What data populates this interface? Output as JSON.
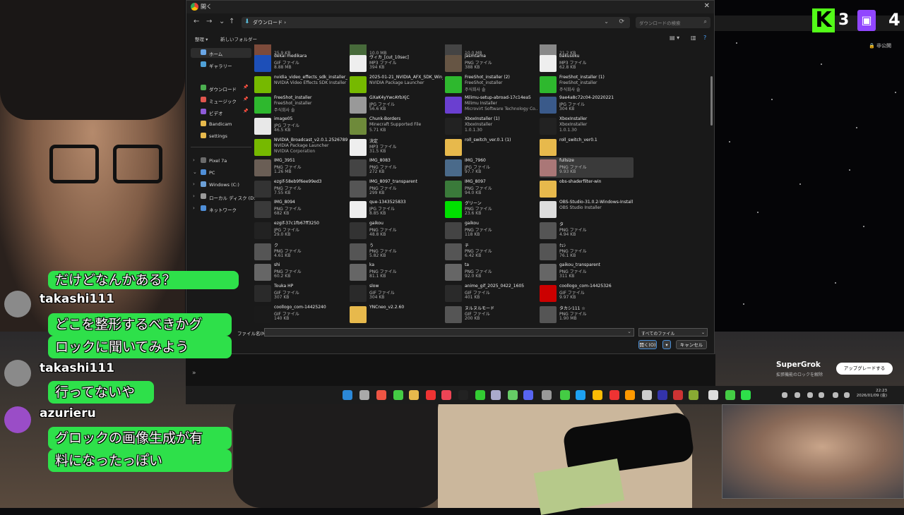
{
  "window": {
    "title": "開く",
    "close": "✕"
  },
  "nav": {
    "back": "←",
    "forward": "→",
    "down": "⌄",
    "up": "↑",
    "path": "ダウンロード",
    "path_sep": "›",
    "chevron": "⌄",
    "refresh": "⟳",
    "search_placeholder": "ダウンロードの検索",
    "search_icon": "⌕"
  },
  "toolbar": {
    "organize": "整理 ▾",
    "new_folder": "新しいフォルダー",
    "view": "▤ ▾",
    "pane": "▥",
    "help": "?"
  },
  "sidebar": [
    {
      "label": "ホーム",
      "color": "#6aa7e8",
      "active": true
    },
    {
      "label": "ギャラリー",
      "color": "#4fa0d6"
    },
    {
      "label": "ダウンロード",
      "color": "#4caf50",
      "pin": "📌"
    },
    {
      "label": "ミュージック",
      "color": "#e0554d",
      "pin": "📌"
    },
    {
      "label": "ビデオ",
      "color": "#8e5bd9",
      "pin": "📌"
    },
    {
      "label": "Bandicam",
      "color": "#e7b94c"
    },
    {
      "label": "settings",
      "color": "#e7b94c"
    },
    {
      "label": "Pixel 7a",
      "color": "#6b6b6b",
      "exp": "›"
    },
    {
      "label": "PC",
      "color": "#4f8fd8",
      "exp": "⌄"
    },
    {
      "label": "Windows (C:)",
      "color": "#6b9fd6",
      "exp": "›"
    },
    {
      "label": "ローカル ディスク (D:",
      "color": "#9a9a9a",
      "exp": "›"
    },
    {
      "label": "ネットワーク",
      "color": "#4f8fd8",
      "exp": "›"
    }
  ],
  "files": [
    [
      {
        "name": "",
        "l2": "",
        "l3": "25.9 KB",
        "color": "#7c4a3a"
      },
      {
        "name": "dekai medikara",
        "l2": "GIF ファイル",
        "l3": "8.88 MB",
        "color": "#1d4fb8"
      },
      {
        "name": "nvidia_video_effects_sdk_installer_v0.7.6_ada",
        "l2": "NVIDIA Video Effects SDK Installer",
        "l3": "",
        "color": "#76b900"
      },
      {
        "name": "FreeShot_installer",
        "l2": "FreeShot_installer",
        "l3": "주식회사 솔",
        "color": "#2eb82e"
      },
      {
        "name": "image05",
        "l2": "JPG ファイル",
        "l3": "46.5 KB",
        "color": "#e8e8e8"
      },
      {
        "name": "NVIDIA_Broadcast_v2.0.1.25267890",
        "l2": "NVIDIA Package Launcher",
        "l3": "NVIDIA Corporation",
        "color": "#76b900"
      },
      {
        "name": "IMG_3951",
        "l2": "PNG ファイル",
        "l3": "1.26 MB",
        "color": "#6a5e55"
      },
      {
        "name": "ezgif-58eb9f6ee99ed3",
        "l2": "PNG ファイル",
        "l3": "7.55 KB",
        "color": "#333"
      },
      {
        "name": "IMG_8094",
        "l2": "PNG ファイル",
        "l3": "682 KB",
        "color": "#3a3a3a"
      },
      {
        "name": "ezgif-37c1fb67ff3250",
        "l2": "JPG ファイル",
        "l3": "29.0 KB",
        "color": "#222"
      },
      {
        "name": "ク",
        "l2": "PNG ファイル",
        "l3": "4.61 KB",
        "color": "#555"
      },
      {
        "name": "shi",
        "l2": "PNG ファイル",
        "l3": "60.2 KB",
        "color": "#666"
      },
      {
        "name": "Touka HP",
        "l2": "GIF ファイル",
        "l3": "307 KB",
        "color": "#2a2a2a"
      },
      {
        "name": "coollogo_com-14425240",
        "l2": "GIF ファイル",
        "l3": "140 KB",
        "color": "#1a1a1a"
      }
    ],
    [
      {
        "name": "",
        "l2": "",
        "l3": "10.0 MB",
        "color": "#476a3a"
      },
      {
        "name": "ヴィカ_[cut_10sec]",
        "l2": "MP3 ファイル",
        "l3": "394 KB",
        "color": "#eee"
      },
      {
        "name": "2025-01-21_NVIDIA_AFX_SDK_Win_v1.6.1.2-GA_Ada",
        "l2": "NVIDIA Package Launcher",
        "l3": "",
        "color": "#76b900"
      },
      {
        "name": "GXaK4yYwcAYbXjC",
        "l2": "JPG ファイル",
        "l3": "56.6 KB",
        "color": "#999"
      },
      {
        "name": "Chunk-Borders",
        "l2": "Minecraft Supported File",
        "l3": "5.71 KB",
        "color": "#6e8a3a"
      },
      {
        "name": "決定",
        "l2": "MP3 ファイル",
        "l3": "31.5 KB",
        "color": "#eee"
      },
      {
        "name": "IMG_8083",
        "l2": "PNG ファイル",
        "l3": "272 KB",
        "color": "#444"
      },
      {
        "name": "IMG_8097_transparent",
        "l2": "PNG ファイル",
        "l3": "299 KB",
        "color": "#555"
      },
      {
        "name": "que-1343525833",
        "l2": "JPG ファイル",
        "l3": "8.85 KB",
        "color": "#eee"
      },
      {
        "name": "gaikou",
        "l2": "PNG ファイル",
        "l3": "48.8 KB",
        "color": "#333"
      },
      {
        "name": "う",
        "l2": "PNG ファイル",
        "l3": "5.82 KB",
        "color": "#555"
      },
      {
        "name": "ka",
        "l2": "PNG ファイル",
        "l3": "81.1 KB",
        "color": "#666"
      },
      {
        "name": "slow",
        "l2": "GIF ファイル",
        "l3": "304 KB",
        "color": "#2a2a2a"
      },
      {
        "name": "YNCneo_v2.2.60",
        "l2": "",
        "l3": "",
        "color": "#e7b94c"
      }
    ],
    [
      {
        "name": "",
        "l2": "",
        "l3": "10.0 MB",
        "color": "#444"
      },
      {
        "name": "jasmtama",
        "l2": "PNG ファイル",
        "l3": "388 KB",
        "color": "#654"
      },
      {
        "name": "FreeShot_installer (2)",
        "l2": "FreeShot_installer",
        "l3": "주식회사 솔",
        "color": "#2eb82e"
      },
      {
        "name": "Milimu-setup-abroad-17c14ea5",
        "l2": "Milimu Installer",
        "l3": "Microvirt Software Technology Co...",
        "color": "#6a3fd0"
      },
      {
        "name": "XboxInstaller (1)",
        "l2": "XboxInstaller",
        "l3": "1.0.1.30",
        "color": "#222"
      },
      {
        "name": "roll_switch_ver.0.1 (1)",
        "l2": "",
        "l3": "",
        "color": "#e7b94c"
      },
      {
        "name": "IMG_7960",
        "l2": "JPG ファイル",
        "l3": "97.7 KB",
        "color": "#4a6a8a"
      },
      {
        "name": "IMG_8097",
        "l2": "PNG ファイル",
        "l3": "94.0 KB",
        "color": "#3a7a3a"
      },
      {
        "name": "グリーン",
        "l2": "PNG ファイル",
        "l3": "23.6 KB",
        "color": "#00e000"
      },
      {
        "name": "gaikou",
        "l2": "PNG ファイル",
        "l3": "118 KB",
        "color": "#444"
      },
      {
        "name": "チ",
        "l2": "PNG ファイル",
        "l3": "6.42 KB",
        "color": "#555"
      },
      {
        "name": "ta",
        "l2": "PNG ファイル",
        "l3": "92.0 KB",
        "color": "#666"
      },
      {
        "name": "anime_gif_2025_0422_1605",
        "l2": "GIF ファイル",
        "l3": "401 KB",
        "color": "#2a2a2a"
      },
      {
        "name": "ヌルヌルモード",
        "l2": "GIF ファイル",
        "l3": "200 KB",
        "color": "#555"
      }
    ],
    [
      {
        "name": "",
        "l2": "",
        "l3": "21.2 KB",
        "color": "#888"
      },
      {
        "name": "bakusoku",
        "l2": "MP3 ファイル",
        "l3": "62.8 KB",
        "color": "#eee"
      },
      {
        "name": "FreeShot_installer (1)",
        "l2": "FreeShot_installer",
        "l3": "주식회사 솔",
        "color": "#2eb82e"
      },
      {
        "name": "9ae4a8c72c04-20220221",
        "l2": "JPG ファイル",
        "l3": "304 KB",
        "color": "#3a5a8a"
      },
      {
        "name": "XboxInstaller",
        "l2": "XboxInstaller",
        "l3": "1.0.1.30",
        "color": "#222"
      },
      {
        "name": "roll_switch_ver0.1",
        "l2": "",
        "l3": "",
        "color": "#e7b94c"
      },
      {
        "name": "fullsize",
        "l2": "PNG ファイル",
        "l3": "9.93 KB",
        "color": "#a77",
        "sel": true
      },
      {
        "name": "obs-shaderfilter-win",
        "l2": "",
        "l3": "",
        "color": "#e7b94c"
      },
      {
        "name": "OBS-Studio-31.0.2-Windows-Installer",
        "l2": "OBS Studio Installer",
        "l3": "",
        "color": "#ddd"
      },
      {
        "name": "タ",
        "l2": "PNG ファイル",
        "l3": "4.94 KB",
        "color": "#555"
      },
      {
        "name": "ｸｪｼ",
        "l2": "PNG ファイル",
        "l3": "76.1 KB",
        "color": "#555"
      },
      {
        "name": "gaikou_transparent",
        "l2": "PNG ファイル",
        "l3": "311 KB",
        "color": "#666"
      },
      {
        "name": "coollogo_com-14425326",
        "l2": "GIF ファイル",
        "l3": "9.97 KB",
        "color": "#c00"
      },
      {
        "name": "タカシ111 ☆",
        "l2": "PNG ファイル",
        "l3": "1.90 MB",
        "color": "#555"
      }
    ]
  ],
  "footer": {
    "filename_label": "ファイル名(N):",
    "filename_value": "",
    "filetype": "すべてのファイル",
    "open": "開く(O)",
    "open_split": "▾",
    "cancel": "キャンセル"
  },
  "taskbar": {
    "time": "22:23",
    "date": "2026/01/09 (金)"
  },
  "overlay": {
    "kick_count": "3",
    "twitch_count": "4",
    "unpublished": "非公開",
    "grok_title": "SuperGrok",
    "grok_sub": "拡張機能のロックを解除",
    "grok_button": "アップグレードする",
    "chat": [
      {
        "type": "msg",
        "text": "だけどなんかある？"
      },
      {
        "type": "user",
        "name": "takashi111"
      },
      {
        "type": "msg",
        "text": "どこを整形するべきかグ"
      },
      {
        "type": "msg",
        "text": "ロックに聞いてみよう"
      },
      {
        "type": "user",
        "name": "takashi111"
      },
      {
        "type": "msg",
        "text": "行ってないや"
      },
      {
        "type": "user",
        "name": "azurieru"
      },
      {
        "type": "msg",
        "text": "グロックの画像生成が有"
      },
      {
        "type": "msg",
        "text": "料になったっぽい"
      }
    ]
  }
}
